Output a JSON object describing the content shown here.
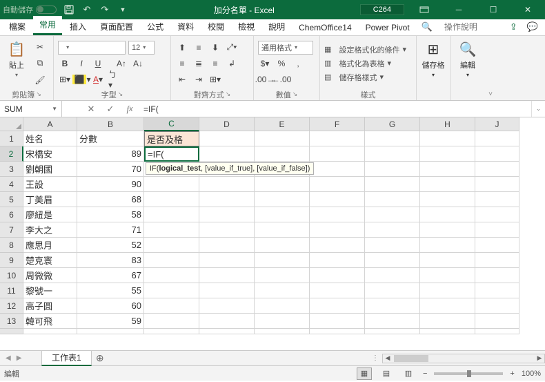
{
  "title": {
    "autosave": "自動儲存",
    "filename": "加分名單 - Excel",
    "cellref": "C264"
  },
  "tabs": [
    "檔案",
    "常用",
    "插入",
    "頁面配置",
    "公式",
    "資料",
    "校閱",
    "檢視",
    "說明",
    "ChemOffice14",
    "Power Pivot"
  ],
  "tabs_search": "操作說明",
  "ribbon": {
    "clipboard": {
      "paste": "貼上",
      "label": "剪貼簿"
    },
    "font": {
      "size": "12",
      "label": "字型"
    },
    "align": {
      "label": "對齊方式"
    },
    "number": {
      "format": "通用格式",
      "label": "數值"
    },
    "styles": {
      "cond": "設定格式化的條件",
      "table": "格式化為表格",
      "cell": "儲存格樣式",
      "label": "樣式"
    },
    "cells": {
      "btn": "儲存格"
    },
    "edit": {
      "btn": "編輯"
    }
  },
  "fbar": {
    "name": "SUM",
    "formula": "=IF("
  },
  "tooltip": "IF(logical_test, [value_if_true], [value_if_false])",
  "cols": [
    "A",
    "B",
    "C",
    "D",
    "E",
    "F",
    "G",
    "H",
    "J"
  ],
  "rows": [
    {
      "n": "1",
      "a": "姓名",
      "b": "分數",
      "c": "是否及格"
    },
    {
      "n": "2",
      "a": "宋橋安",
      "b": "89",
      "c": "=IF("
    },
    {
      "n": "3",
      "a": "劉朝國",
      "b": "70"
    },
    {
      "n": "4",
      "a": "王設",
      "b": "90"
    },
    {
      "n": "5",
      "a": "丁美眉",
      "b": "68"
    },
    {
      "n": "6",
      "a": "廖紐是",
      "b": "58"
    },
    {
      "n": "7",
      "a": "李大之",
      "b": "71"
    },
    {
      "n": "8",
      "a": "應思月",
      "b": "52"
    },
    {
      "n": "9",
      "a": "楚克寰",
      "b": "83"
    },
    {
      "n": "10",
      "a": "周微微",
      "b": "67"
    },
    {
      "n": "11",
      "a": "黎號一",
      "b": "55"
    },
    {
      "n": "12",
      "a": "高子圓",
      "b": "60"
    },
    {
      "n": "13",
      "a": "韓可飛",
      "b": "59"
    }
  ],
  "sheet": "工作表1",
  "status": {
    "mode": "編輯",
    "zoom": "100%"
  }
}
